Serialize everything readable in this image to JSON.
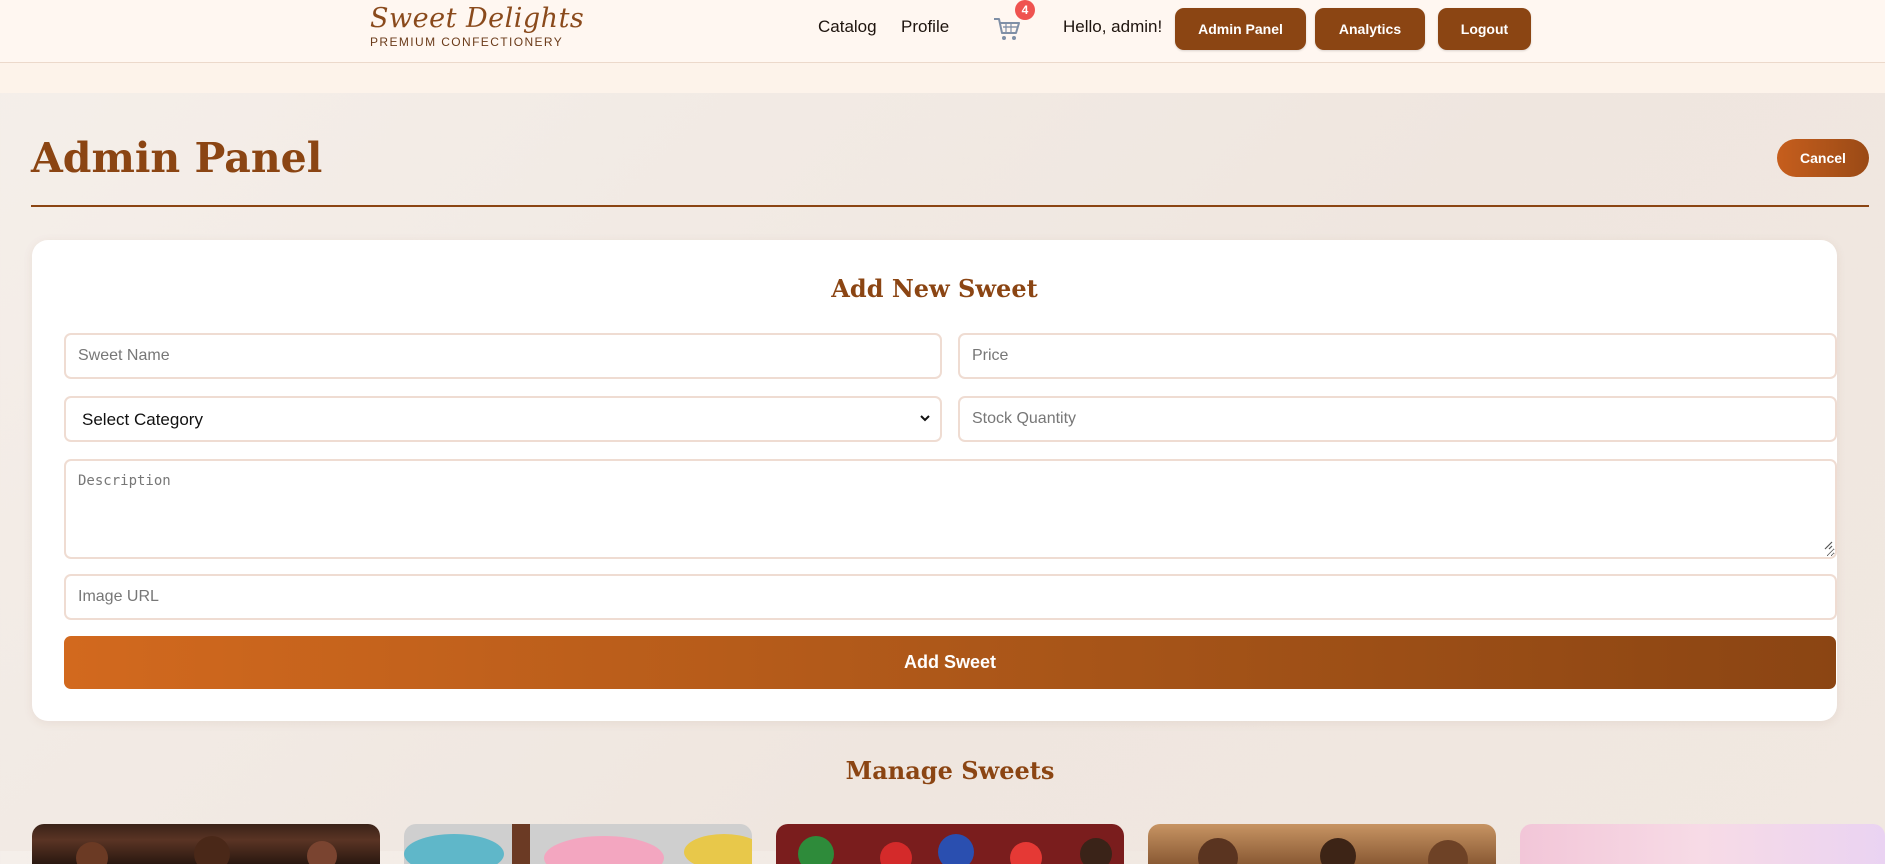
{
  "header": {
    "brand_name": "Sweet Delights",
    "brand_tagline": "PREMIUM CONFECTIONERY",
    "nav": {
      "catalog": "Catalog",
      "profile": "Profile"
    },
    "cart_icon": "cart-icon",
    "cart_count": "4",
    "greeting": "Hello, admin!",
    "buttons": {
      "admin_panel": "Admin Panel",
      "analytics": "Analytics",
      "logout": "Logout"
    }
  },
  "page": {
    "title": "Admin Panel",
    "cancel_label": "Cancel"
  },
  "form": {
    "title": "Add New Sweet",
    "name_placeholder": "Sweet Name",
    "price_placeholder": "Price",
    "category_selected": "Select Category",
    "stock_placeholder": "Stock Quantity",
    "description_placeholder": "Description",
    "image_placeholder": "Image URL",
    "submit_label": "Add Sweet"
  },
  "manage": {
    "title": "Manage Sweets",
    "thumbnails": [
      {
        "subject": "chocolate truffles"
      },
      {
        "subject": "macarons"
      },
      {
        "subject": "gummy candies"
      },
      {
        "subject": "caramel chocolates"
      },
      {
        "subject": "pastel sweets"
      }
    ]
  },
  "colors": {
    "brand_brown": "#8b4513",
    "accent_orange": "#d2691e",
    "badge_red": "#ef5350"
  }
}
